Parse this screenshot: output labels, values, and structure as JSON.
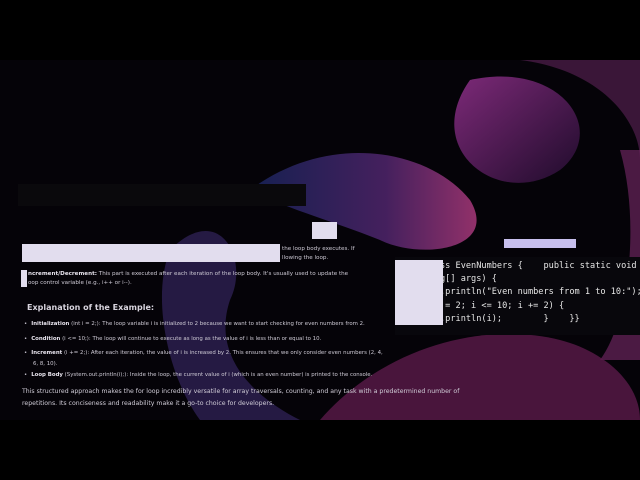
{
  "text": {
    "init_tail_1": "the loop body executes. If",
    "init_tail_2": "llowing the loop.",
    "incdec_label": "ncrement/Decrement:",
    "incdec_text": " This part is executed after each iteration of the loop body. It's usually used to update the",
    "incdec_text2": "oop control variable (e.g., i++ or i--).",
    "heading": "Explanation of the Example:",
    "bullets": [
      {
        "label": "Initialization",
        "text": " (int i = 2;): The loop variable i is initialized to 2 because we want to start checking for even numbers from 2."
      },
      {
        "label": "Condition",
        "text": " (i <= 10;): The loop will continue to execute as long as the value of i is less than or equal to 10."
      },
      {
        "label": "Increment",
        "text": " (i += 2;): After each iteration, the value of i is increased by 2. This ensures that we only consider even numbers (2, 4,"
      },
      {
        "label": "",
        "text": "6, 8, 10)."
      },
      {
        "label": "Loop Body",
        "text": " (System.out.println(i);): Inside the loop, the current value of i (which is an even number) is printed to the console."
      }
    ],
    "para1": "This structured approach makes the for loop incredibly versatile for array traversals, counting, and any task with a predetermined number of",
    "para2": "repetitions. Its conciseness and readability make it a go-to choice for developers."
  },
  "code": [
    "ss EvenNumbers {    public static void",
    "g[] args) {",
    ".println(\"Even numbers from 1 to 10:\");",
    " = 2; i <= 10; i += 2) {",
    ".println(i);        }    }}"
  ]
}
